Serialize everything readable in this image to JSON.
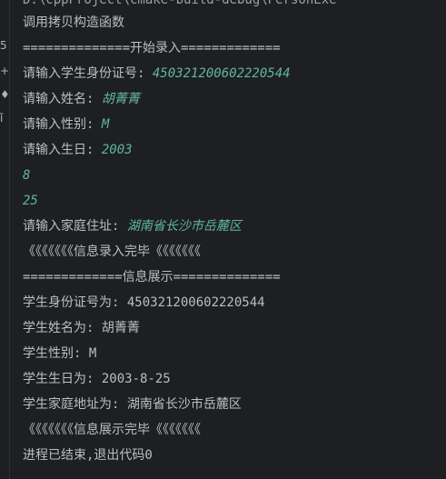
{
  "gutter": {
    "glyphs": [
      "5",
      "+",
      "♦",
      "ǐ"
    ]
  },
  "console": {
    "command": "D:\\cppProject\\cmake-build-debug\\PersonExe",
    "copy_ctor": "调用拷贝构造函数",
    "start_banner": "==============开始录入=============",
    "prompt_id": "请输入学生身份证号: ",
    "input_id": "450321200602220544",
    "prompt_name": "请输入姓名: ",
    "input_name": "胡菁菁",
    "prompt_gender": "请输入性别: ",
    "input_gender": "M",
    "prompt_birthday": "请输入生日: ",
    "input_year": "2003",
    "input_month": "8",
    "input_day": "25",
    "prompt_address": "请输入家庭住址: ",
    "input_address": "湖南省长沙市岳麓区",
    "input_done": "《《《《《《《信息录入完毕《《《《《《《",
    "display_banner": "=============信息展示==============",
    "out_id": "学生身份证号为: 450321200602220544",
    "out_name": "学生姓名为: 胡菁菁",
    "out_gender": "学生性别: M",
    "out_birthday": "学生生日为: 2003-8-25",
    "out_address": "学生家庭地址为: 湖南省长沙市岳麓区",
    "display_done": "《《《《《《《信息展示完毕《《《《《《《",
    "exit_message": "进程已结束,退出代码0"
  },
  "colors": {
    "background": "#1e1f22",
    "text": "#bcbec4",
    "user_input": "#5fb89a"
  }
}
